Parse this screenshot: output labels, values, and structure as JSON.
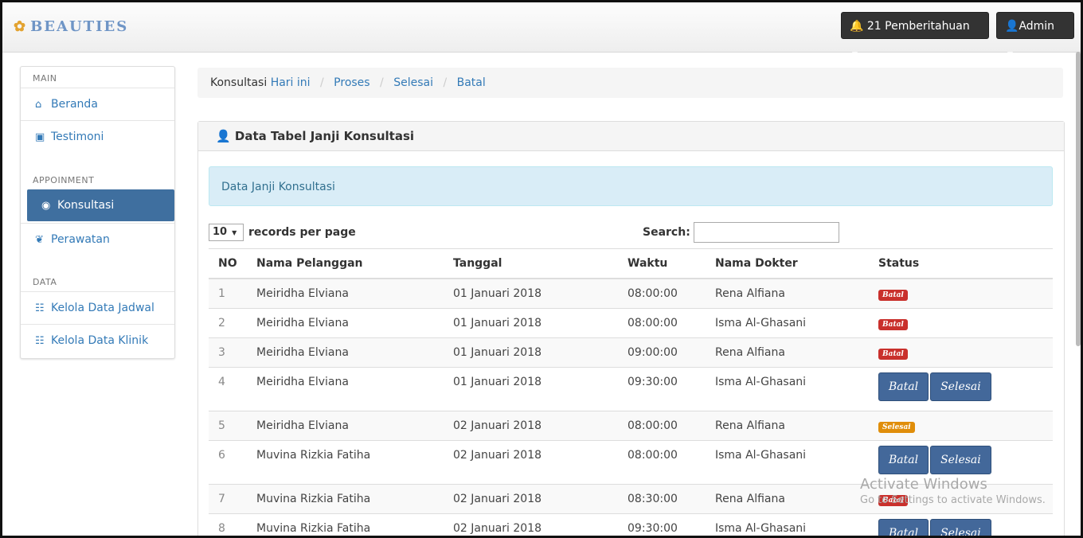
{
  "app": {
    "brand": "Beauties"
  },
  "navbar": {
    "notifications_label": "21 Pemberitahuan",
    "admin_label": "Admin"
  },
  "sidebar": {
    "sections": [
      {
        "heading": "MAIN"
      },
      {
        "heading": "APPOINMENT"
      },
      {
        "heading": "DATA"
      }
    ],
    "items": [
      {
        "label": "Beranda",
        "icon": "home-icon"
      },
      {
        "label": "Testimoni",
        "icon": "inbox-icon"
      },
      {
        "label": "Konsultasi",
        "icon": "eye-icon",
        "active": true
      },
      {
        "label": "Perawatan",
        "icon": "leaf-icon"
      },
      {
        "label": "Kelola Data Jadwal",
        "icon": "list-icon"
      },
      {
        "label": "Kelola Data Klinik",
        "icon": "list-icon"
      }
    ]
  },
  "breadcrumb": {
    "first": "Konsultasi",
    "links": [
      "Hari ini",
      "Proses",
      "Selesai",
      "Batal"
    ]
  },
  "panel": {
    "title": "Data Tabel Janji Konsultasi",
    "alert": "Data Janji Konsultasi",
    "length_value": "10",
    "length_suffix": "records per page",
    "search_label": "Search:"
  },
  "table": {
    "headers": [
      "NO",
      "Nama Pelanggan",
      "Tanggal",
      "Waktu",
      "Nama Dokter",
      "Status"
    ],
    "rows": [
      {
        "no": "1",
        "nama": "Meiridha Elviana",
        "tanggal": "01 Januari 2018",
        "waktu": "08:00:00",
        "dokter": "Rena Alfiana",
        "status": "Batal"
      },
      {
        "no": "2",
        "nama": "Meiridha Elviana",
        "tanggal": "01 Januari 2018",
        "waktu": "08:00:00",
        "dokter": "Isma Al-Ghasani",
        "status": "Batal"
      },
      {
        "no": "3",
        "nama": "Meiridha Elviana",
        "tanggal": "01 Januari 2018",
        "waktu": "09:00:00",
        "dokter": "Rena Alfiana",
        "status": "Batal"
      },
      {
        "no": "4",
        "nama": "Meiridha Elviana",
        "tanggal": "01 Januari 2018",
        "waktu": "09:30:00",
        "dokter": "Isma Al-Ghasani",
        "action_batal": "Batal",
        "action_selesai": "Selesai"
      },
      {
        "no": "5",
        "nama": "Meiridha Elviana",
        "tanggal": "02 Januari 2018",
        "waktu": "08:00:00",
        "dokter": "Rena Alfiana",
        "status": "Selesai"
      },
      {
        "no": "6",
        "nama": "Muvina Rizkia Fatiha",
        "tanggal": "02 Januari 2018",
        "waktu": "08:00:00",
        "dokter": "Isma Al-Ghasani",
        "action_batal": "Batal",
        "action_selesai": "Selesai"
      },
      {
        "no": "7",
        "nama": "Muvina Rizkia Fatiha",
        "tanggal": "02 Januari 2018",
        "waktu": "08:30:00",
        "dokter": "Rena Alfiana",
        "status": "Batal"
      },
      {
        "no": "8",
        "nama": "Muvina Rizkia Fatiha",
        "tanggal": "02 Januari 2018",
        "waktu": "09:30:00",
        "dokter": "Isma Al-Ghasani",
        "action_batal": "Batal",
        "action_selesai": "Selesai"
      }
    ]
  },
  "watermark": {
    "line1": "Activate Windows",
    "line2": "Go to Settings to activate Windows."
  },
  "colors": {
    "sidebar_active": "#3f6f9f",
    "link": "#337ab7",
    "label_batal": "#c9302c",
    "label_selesai": "#e08e0b",
    "action_button": "#43689a"
  }
}
